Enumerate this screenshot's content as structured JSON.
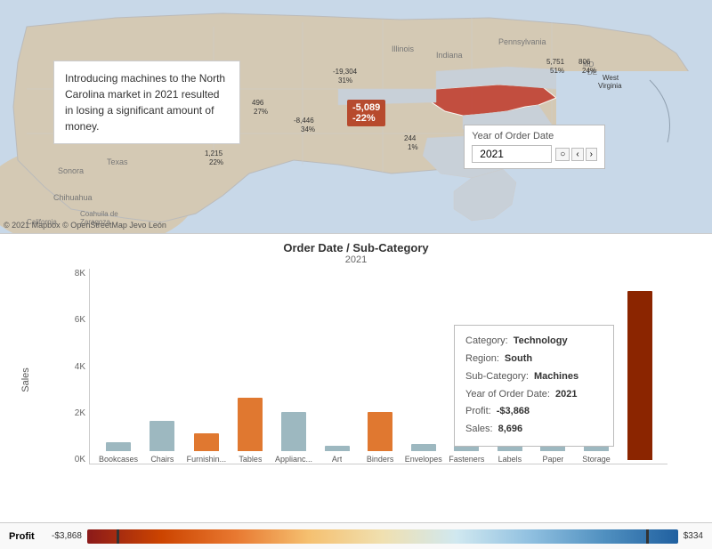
{
  "map": {
    "tooltip": "Introducing machines to the North Carolina market in 2021 resulted in losing a significant amount of money.",
    "nc_value": "-5,089",
    "nc_pct": "-22%",
    "attribution": "© 2021 Mapbox © OpenStreetMap Jevo León",
    "filter_label": "Year of Order Date",
    "filter_value": "2021"
  },
  "chart": {
    "title": "Order Date / Sub-Category",
    "subtitle": "2021",
    "y_label": "Sales",
    "y_ticks": [
      "8K",
      "6K",
      "4K",
      "2K",
      "0K"
    ],
    "bars": [
      {
        "label": "Bookcases",
        "height_pct": 5,
        "color": "#9db8c0"
      },
      {
        "label": "Chairs",
        "height_pct": 17,
        "color": "#9db8c0"
      },
      {
        "label": "Furnishin...",
        "height_pct": 10,
        "color": "#e07830"
      },
      {
        "label": "Tables",
        "height_pct": 30,
        "color": "#e07830"
      },
      {
        "label": "Applianc...",
        "height_pct": 22,
        "color": "#9db8c0"
      },
      {
        "label": "Art",
        "height_pct": 3,
        "color": "#9db8c0"
      },
      {
        "label": "Binders",
        "height_pct": 22,
        "color": "#e07830"
      },
      {
        "label": "Envelopes",
        "height_pct": 4,
        "color": "#9db8c0"
      },
      {
        "label": "Fasteners",
        "height_pct": 3,
        "color": "#9db8c0"
      },
      {
        "label": "Labels",
        "height_pct": 4,
        "color": "#9db8c0"
      },
      {
        "label": "Paper",
        "height_pct": 10,
        "color": "#9db8c0"
      },
      {
        "label": "Storage",
        "height_pct": 13,
        "color": "#9db8c0"
      },
      {
        "label": "",
        "height_pct": 95,
        "color": "#8b2500"
      }
    ],
    "tooltip": {
      "category_key": "Category:",
      "category_val": "Technology",
      "region_key": "Region:",
      "region_val": "South",
      "subcategory_key": "Sub-Category:",
      "subcategory_val": "Machines",
      "year_key": "Year of Order Date:",
      "year_val": "2021",
      "profit_key": "Profit:",
      "profit_val": "-$3,868",
      "sales_key": "Sales:",
      "sales_val": "8,696"
    }
  },
  "profit": {
    "label": "Profit",
    "min": "-$3,868",
    "max": "$334"
  }
}
